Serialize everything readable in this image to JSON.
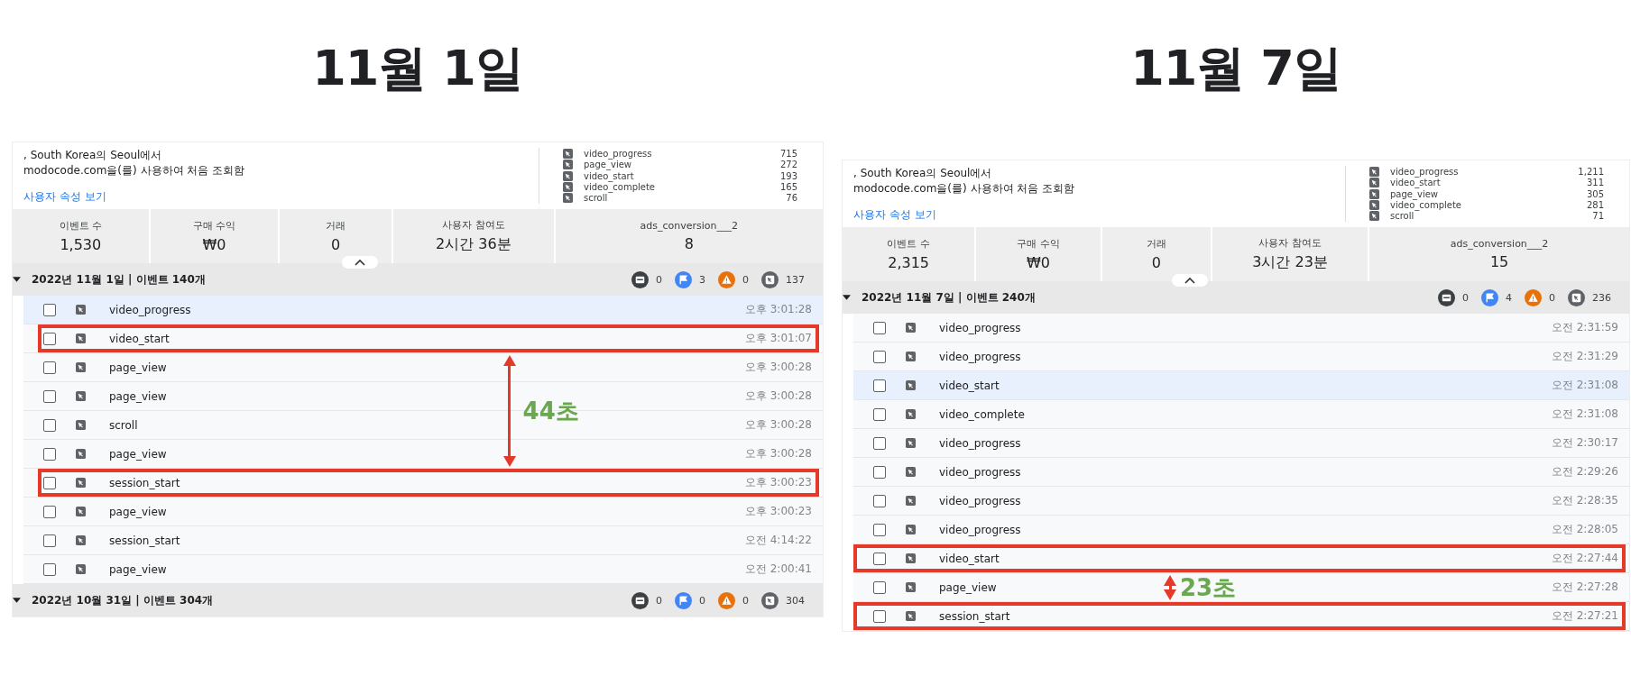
{
  "panels": [
    {
      "title": "11월 1일",
      "info": {
        "lines": [
          ", South Korea의 Seoul에서",
          "modocode.com을(를) 사용하여 처음 조회함"
        ],
        "link": "사용자 속성 보기"
      },
      "event_counts": [
        {
          "name": "video_progress",
          "count": "715"
        },
        {
          "name": "page_view",
          "count": "272"
        },
        {
          "name": "video_start",
          "count": "193"
        },
        {
          "name": "video_complete",
          "count": "165"
        },
        {
          "name": "scroll",
          "count": "76"
        }
      ],
      "stats": [
        {
          "label": "이벤트 수",
          "value": "1,530"
        },
        {
          "label": "구매 수익",
          "value": "₩0"
        },
        {
          "label": "거래",
          "value": "0"
        },
        {
          "label": "사용자 참여도",
          "value": "2시간 36분"
        },
        {
          "label": "ads_conversion___2",
          "value": "8"
        }
      ],
      "groups": [
        {
          "title": "2022년 11월 1일 | 이벤트 140개",
          "expanded": true,
          "chips": [
            {
              "kind": "screen",
              "count": "0"
            },
            {
              "kind": "flag",
              "count": "3"
            },
            {
              "kind": "warning",
              "count": "0"
            },
            {
              "kind": "event",
              "count": "137"
            }
          ],
          "rows": [
            {
              "name": "video_progress",
              "time": "오후 3:01:28",
              "selected": true,
              "highlighted": false
            },
            {
              "name": "video_start",
              "time": "오후 3:01:07",
              "selected": false,
              "highlighted": true
            },
            {
              "name": "page_view",
              "time": "오후 3:00:28",
              "selected": false,
              "highlighted": false
            },
            {
              "name": "page_view",
              "time": "오후 3:00:28",
              "selected": false,
              "highlighted": false
            },
            {
              "name": "scroll",
              "time": "오후 3:00:28",
              "selected": false,
              "highlighted": false
            },
            {
              "name": "page_view",
              "time": "오후 3:00:28",
              "selected": false,
              "highlighted": false
            },
            {
              "name": "session_start",
              "time": "오후 3:00:23",
              "selected": false,
              "highlighted": true
            },
            {
              "name": "page_view",
              "time": "오후 3:00:23",
              "selected": false,
              "highlighted": false
            },
            {
              "name": "session_start",
              "time": "오전 4:14:22",
              "selected": false,
              "highlighted": false
            },
            {
              "name": "page_view",
              "time": "오전 2:00:41",
              "selected": false,
              "highlighted": false
            }
          ],
          "annotation": "44초"
        },
        {
          "title": "2022년 10월 31일 | 이벤트 304개",
          "expanded": true,
          "chips": [
            {
              "kind": "screen",
              "count": "0"
            },
            {
              "kind": "flag",
              "count": "0"
            },
            {
              "kind": "warning",
              "count": "0"
            },
            {
              "kind": "event",
              "count": "304"
            }
          ]
        }
      ]
    },
    {
      "title": "11월 7일",
      "info": {
        "lines": [
          ", South Korea의 Seoul에서",
          "modocode.com을(를) 사용하여 처음 조회함"
        ],
        "link": "사용자 속성 보기"
      },
      "event_counts": [
        {
          "name": "video_progress",
          "count": "1,211"
        },
        {
          "name": "video_start",
          "count": "311"
        },
        {
          "name": "page_view",
          "count": "305"
        },
        {
          "name": "video_complete",
          "count": "281"
        },
        {
          "name": "scroll",
          "count": "71"
        }
      ],
      "stats": [
        {
          "label": "이벤트 수",
          "value": "2,315"
        },
        {
          "label": "구매 수익",
          "value": "₩0"
        },
        {
          "label": "거래",
          "value": "0"
        },
        {
          "label": "사용자 참여도",
          "value": "3시간 23분"
        },
        {
          "label": "ads_conversion___2",
          "value": "15"
        }
      ],
      "groups": [
        {
          "title": "2022년 11월 7일 | 이벤트 240개",
          "expanded": true,
          "chips": [
            {
              "kind": "screen",
              "count": "0"
            },
            {
              "kind": "flag",
              "count": "4"
            },
            {
              "kind": "warning",
              "count": "0"
            },
            {
              "kind": "event",
              "count": "236"
            }
          ],
          "rows": [
            {
              "name": "video_progress",
              "time": "오전 2:31:59",
              "selected": false,
              "highlighted": false
            },
            {
              "name": "video_progress",
              "time": "오전 2:31:29",
              "selected": false,
              "highlighted": false
            },
            {
              "name": "video_start",
              "time": "오전 2:31:08",
              "selected": true,
              "highlighted": false
            },
            {
              "name": "video_complete",
              "time": "오전 2:31:08",
              "selected": false,
              "highlighted": false
            },
            {
              "name": "video_progress",
              "time": "오전 2:30:17",
              "selected": false,
              "highlighted": false
            },
            {
              "name": "video_progress",
              "time": "오전 2:29:26",
              "selected": false,
              "highlighted": false
            },
            {
              "name": "video_progress",
              "time": "오전 2:28:35",
              "selected": false,
              "highlighted": false
            },
            {
              "name": "video_progress",
              "time": "오전 2:28:05",
              "selected": false,
              "highlighted": false
            },
            {
              "name": "video_start",
              "time": "오전 2:27:44",
              "selected": false,
              "highlighted": true
            },
            {
              "name": "page_view",
              "time": "오전 2:27:28",
              "selected": false,
              "highlighted": false
            },
            {
              "name": "session_start",
              "time": "오전 2:27:21",
              "selected": false,
              "highlighted": true
            }
          ],
          "annotation": "23초"
        }
      ]
    }
  ]
}
